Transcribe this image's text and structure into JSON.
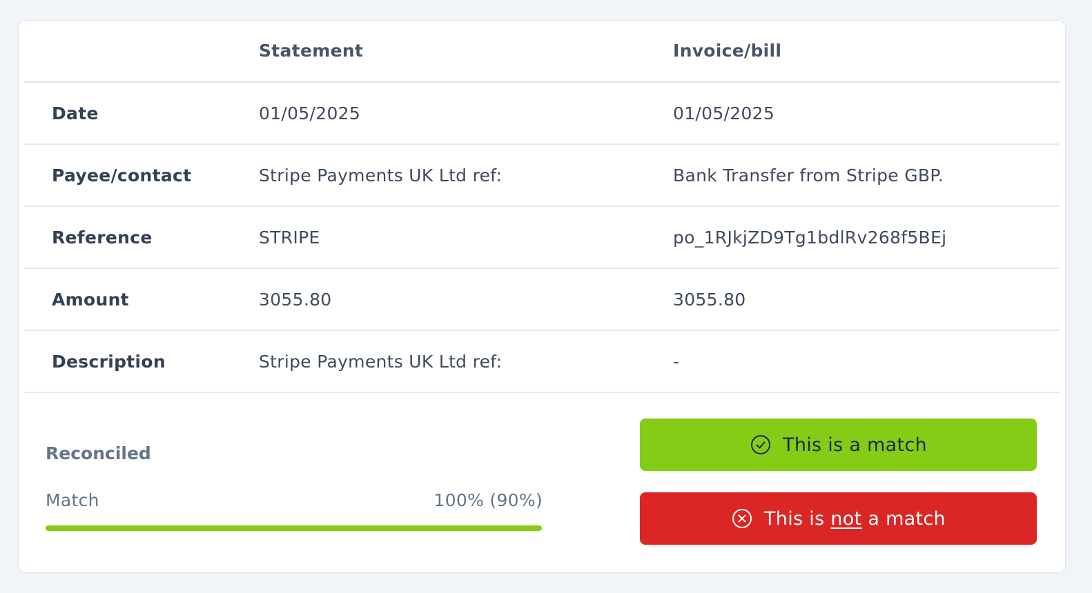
{
  "table": {
    "headers": {
      "label": "",
      "statement": "Statement",
      "invoice": "Invoice/bill"
    },
    "rows": [
      {
        "label": "Date",
        "statement": "01/05/2025",
        "invoice": "01/05/2025"
      },
      {
        "label": "Payee/contact",
        "statement": "Stripe Payments UK Ltd ref:",
        "invoice": "Bank Transfer from Stripe GBP."
      },
      {
        "label": "Reference",
        "statement": "STRIPE",
        "invoice": "po_1RJkjZD9Tg1bdlRv268f5BEj"
      },
      {
        "label": "Amount",
        "statement": "3055.80",
        "invoice": "3055.80"
      },
      {
        "label": "Description",
        "statement": "Stripe Payments UK Ltd ref:",
        "invoice": "-"
      }
    ]
  },
  "status": {
    "title": "Reconciled",
    "match_label": "Match",
    "match_value": "100% (90%)",
    "progress_fraction": 1.0
  },
  "actions": {
    "match": {
      "icon": "check-circle-icon",
      "label": "This is a match"
    },
    "not_match": {
      "icon": "x-circle-icon",
      "label_before": "This is ",
      "label_emphasis": "not",
      "label_after": " a match"
    }
  },
  "colors": {
    "match": "#84cc16",
    "not_match": "#dc2626",
    "progress": "#84cc16"
  }
}
